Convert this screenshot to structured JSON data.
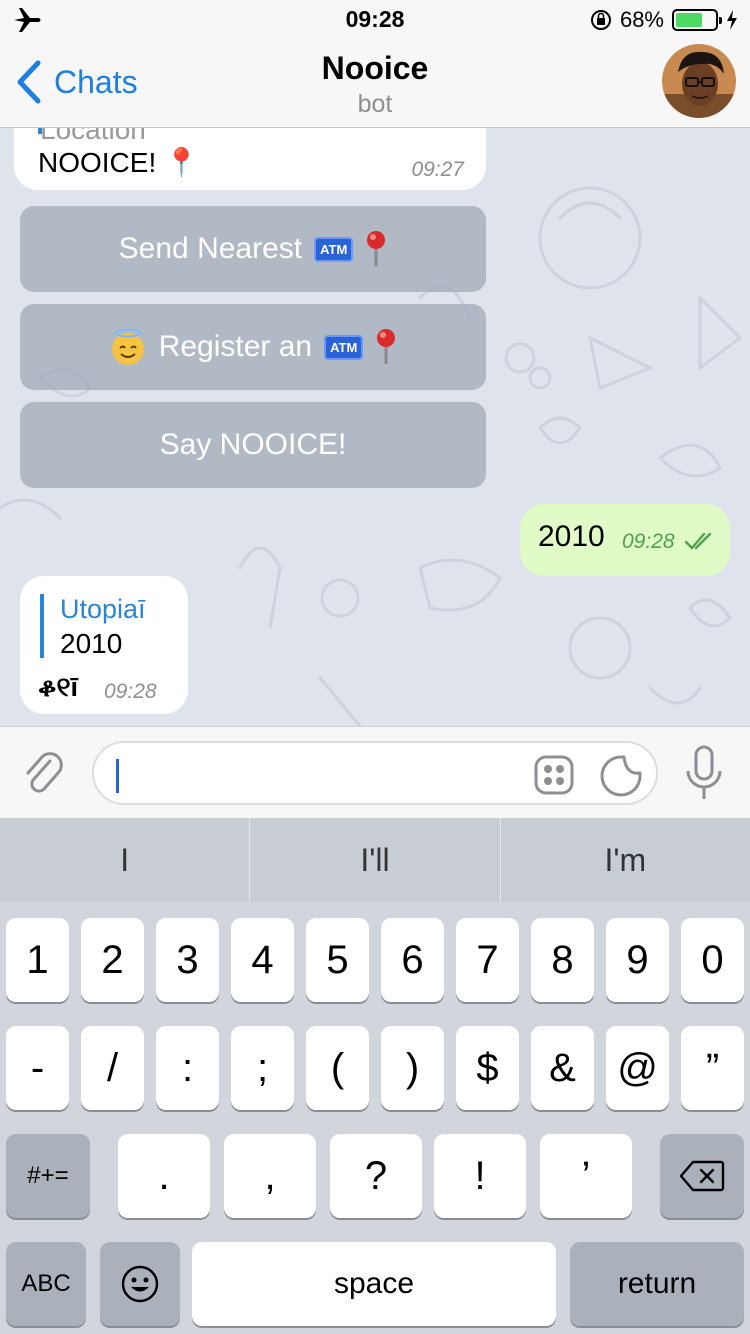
{
  "status_bar": {
    "time": "09:28",
    "battery_pct": "68%",
    "battery_level": 0.68,
    "battery_color": "#4cd964"
  },
  "nav": {
    "back_label": "Chats",
    "title": "Nooice",
    "subtitle": "bot"
  },
  "messages": {
    "first": {
      "reply_label": "Location",
      "text": "NOOICE! 📍",
      "time": "09:27"
    },
    "keyboard_buttons": [
      {
        "label": "Send Nearest",
        "icons": [
          "atm-icon",
          "pin-icon"
        ]
      },
      {
        "label": "Register an",
        "icons": [
          "halo-emoji-icon",
          "atm-icon",
          "pin-icon"
        ]
      },
      {
        "label": "Say NOOICE!"
      }
    ],
    "outgoing": {
      "text": "2010",
      "time": "09:28"
    },
    "incoming": {
      "reply_name": "Utopiaī",
      "reply_text": "2010",
      "text": "ቆ୧ī",
      "time": "09:28"
    }
  },
  "atm_label": "ATM",
  "input": {
    "placeholder": "",
    "value": ""
  },
  "keyboard": {
    "suggestions": [
      "I",
      "I'll",
      "I'm"
    ],
    "row1": [
      "1",
      "2",
      "3",
      "4",
      "5",
      "6",
      "7",
      "8",
      "9",
      "0"
    ],
    "row2": [
      "-",
      "/",
      ":",
      ";",
      "(",
      ")",
      "$",
      "&",
      "@",
      "”"
    ],
    "row3": {
      "mode": "#+=",
      "keys": [
        ".",
        ",",
        "?",
        "!",
        "’"
      ]
    },
    "row4": {
      "abc": "ABC",
      "space": "space",
      "return": "return"
    }
  },
  "colors": {
    "accent": "#1d7fe4",
    "outgoing_bubble": "#e0fbc5",
    "chat_bg": "#dfe4ec"
  }
}
